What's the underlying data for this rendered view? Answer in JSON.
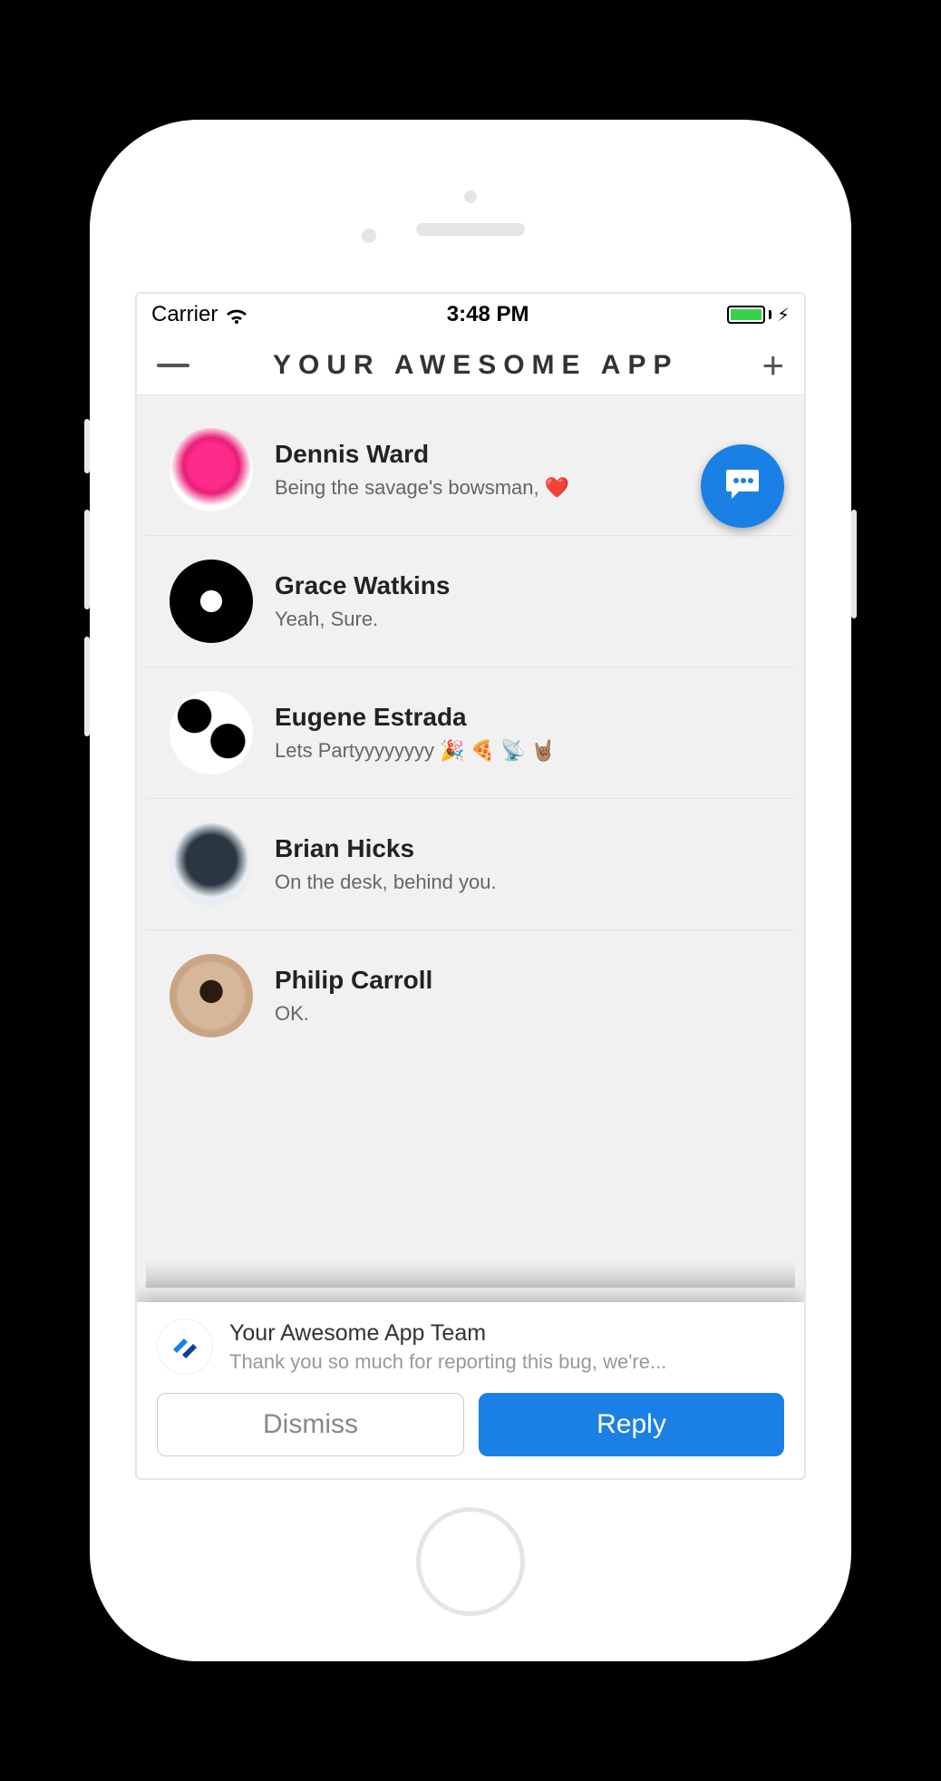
{
  "status": {
    "carrier": "Carrier",
    "time": "3:48 PM"
  },
  "nav": {
    "title": "YOUR AWESOME APP"
  },
  "contacts": [
    {
      "name": "Dennis Ward",
      "message": "Being the savage's bowsman, ❤️"
    },
    {
      "name": "Grace Watkins",
      "message": "Yeah, Sure."
    },
    {
      "name": "Eugene Estrada",
      "message": "Lets Partyyyyyyyy 🎉 🍕 📡 🤘🏽"
    },
    {
      "name": "Brian Hicks",
      "message": "On the desk, behind you."
    },
    {
      "name": "Philip Carroll",
      "message": "OK."
    }
  ],
  "notification": {
    "title": "Your Awesome App Team",
    "body": "Thank you so much for reporting this bug, we're...",
    "dismiss_label": "Dismiss",
    "reply_label": "Reply"
  },
  "colors": {
    "accent": "#1a80e6"
  }
}
